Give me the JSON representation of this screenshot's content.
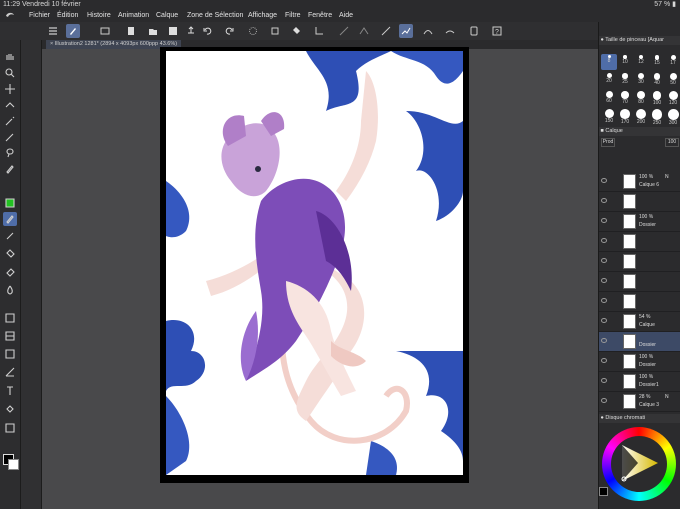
{
  "statusbar": {
    "time": "11:29",
    "date": "Vendredi 10 février",
    "battery": "57 %"
  },
  "menu": [
    "Fichier",
    "Édition",
    "Histoire",
    "Animation",
    "Calque",
    "Zone de Sélection",
    "Affichage",
    "Filtre",
    "Fenêtre",
    "Aide"
  ],
  "tab": {
    "label": "Illustration2 1281* (2894 x 4093px 600ppp 43.6%)"
  },
  "brush_panel": {
    "title": "Taille de pinceau [Aquar",
    "sizes": [
      "8",
      "10",
      "12",
      "15",
      "17",
      "20",
      "25",
      "30",
      "40",
      "50",
      "60",
      "70",
      "80",
      "100",
      "120",
      "150",
      "170",
      "200",
      "250",
      "300"
    ],
    "selected": "8"
  },
  "layer_panel": {
    "title": "Calque",
    "blend_mode": "Prod",
    "opacity": "100",
    "layers": [
      {
        "opacity": "100 %",
        "mode": "N",
        "name": "Calque 6"
      },
      {
        "opacity": "",
        "mode": "",
        "name": ""
      },
      {
        "opacity": "100 %",
        "mode": "",
        "name": "Dossier"
      },
      {
        "opacity": "",
        "mode": "",
        "name": ""
      },
      {
        "opacity": "",
        "mode": "",
        "name": ""
      },
      {
        "opacity": "",
        "mode": "",
        "name": ""
      },
      {
        "opacity": "",
        "mode": "",
        "name": ""
      },
      {
        "opacity": "54 %",
        "mode": "",
        "name": "Calque"
      },
      {
        "opacity": "",
        "mode": "",
        "name": "Dossier"
      },
      {
        "opacity": "100 %",
        "mode": "",
        "name": "Dossier"
      },
      {
        "opacity": "100 %",
        "mode": "",
        "name": "Dossier1"
      },
      {
        "opacity": "28 %",
        "mode": "N",
        "name": "Calque 3"
      }
    ]
  },
  "color_panel": {
    "title": "Disque chromati"
  },
  "icons": {
    "tools": [
      "hand-icon",
      "zoom-icon",
      "move-icon",
      "layer-move-icon",
      "magic-wand-icon",
      "eyedropper-icon",
      "lasso-icon",
      "pen-icon",
      "green-color-icon",
      "pencil-icon",
      "brush-icon",
      "fill-icon",
      "eraser-icon",
      "blend-icon",
      "shape-icon",
      "frame-icon",
      "gradient-icon",
      "ruler-icon",
      "text-icon",
      "correct-icon",
      "selection-icon"
    ],
    "commands": [
      "menu-icon",
      "pen-tool-icon",
      "browser-icon",
      "new-icon",
      "open-icon",
      "save-icon",
      "export-icon",
      "undo-icon",
      "redo-icon",
      "spinner-icon",
      "transform-icon",
      "bucket-icon"
    ]
  }
}
